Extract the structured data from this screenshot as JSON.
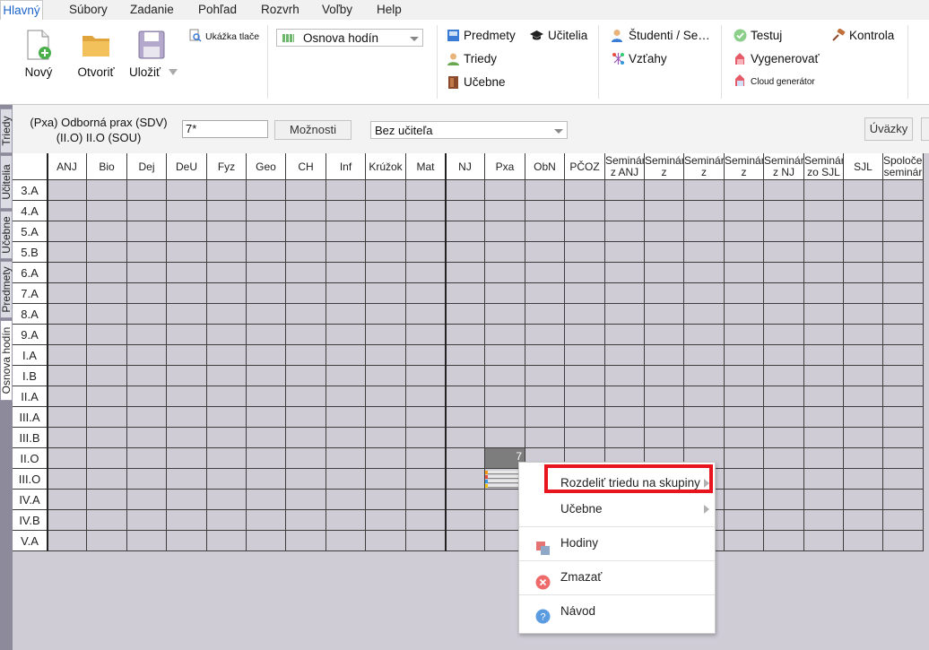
{
  "menu": {
    "tabs": [
      "Hlavný",
      "Súbory",
      "Zadanie",
      "Pohľad",
      "Rozvrh",
      "Voľby",
      "Help"
    ]
  },
  "ribbon": {
    "new_label": "Nový",
    "open_label": "Otvoriť",
    "save_label": "Uložiť",
    "print_preview_label": "Ukážka tlače",
    "view_combo_value": "Osnova hodín",
    "subjects_label": "Predmety",
    "teachers_label": "Učitelia",
    "classes_label": "Triedy",
    "classrooms_label": "Učebne",
    "students_label": "Študenti / Se…",
    "relations_label": "Vzťahy",
    "test_label": "Testuj",
    "check_label": "Kontrola",
    "generate_label": "Vygenerovať",
    "cloud_label": "Cloud generátor"
  },
  "sidetabs": [
    "Triedy",
    "Učitelia",
    "Učebne",
    "Predmety",
    "Osnova hodín"
  ],
  "toolbar": {
    "subject_line1": "(Pxa) Odborná prax (SDV)",
    "subject_line2": "(II.O) II.O (SOU)",
    "hours_value": "7*",
    "options_button": "Možnosti",
    "teacher_combo": "Bez učiteľa",
    "uvazky_button": "Úväzky"
  },
  "grid": {
    "columns": [
      "ANJ",
      "Bio",
      "Dej",
      "DeU",
      "Fyz",
      "Geo",
      "CH",
      "Inf",
      "Krúžok",
      "Mat",
      "NJ",
      "Pxa",
      "ObN",
      "PČOZ",
      "Seminár z ANJ",
      "Seminár z biológie",
      "Seminár z chémie",
      "Seminár z matematiky",
      "Seminár z NJ",
      "Seminár zo SJL",
      "SJL",
      "Spoločenskovedný seminár"
    ],
    "rows": [
      "3.A",
      "4.A",
      "5.A",
      "5.B",
      "6.A",
      "7.A",
      "8.A",
      "9.A",
      "I.A",
      "I.B",
      "II.A",
      "III.A",
      "III.B",
      "II.O",
      "III.O",
      "IV.A",
      "IV.B",
      "V.A"
    ],
    "selected_cell_value": "7",
    "marker_value": "7"
  },
  "context_menu": {
    "items": [
      "Rozdeliť triedu na skupiny",
      "Učebne",
      "Hodiny",
      "Zmazať",
      "Návod"
    ],
    "highlight_color": "#e8141e"
  },
  "colors": {
    "accent": "#1e64c8",
    "grid_bg": "#cfccd6"
  }
}
